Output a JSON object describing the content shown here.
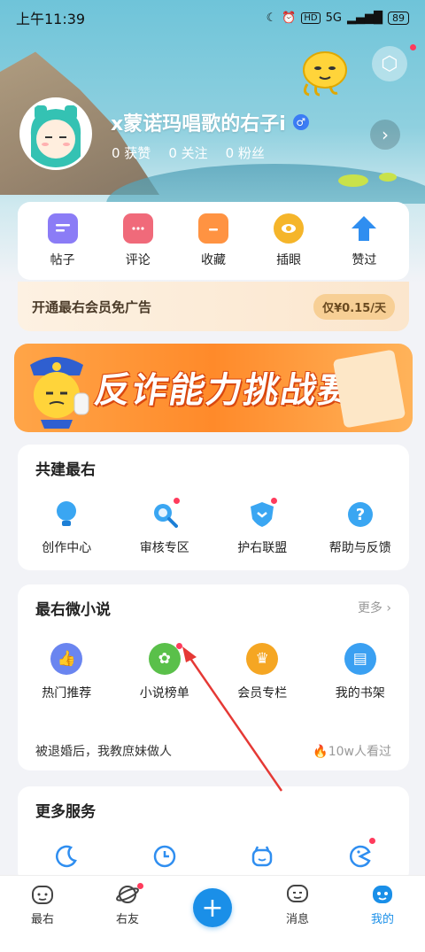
{
  "status_bar": {
    "time": "上午11:39",
    "network": "5G",
    "hd": "HD",
    "battery": "89"
  },
  "profile": {
    "username": "x蒙诺玛唱歌的右子i",
    "gender_symbol": "♂",
    "likes": "0 获赞",
    "following": "0 关注",
    "fans": "0 粉丝"
  },
  "quick_actions": [
    {
      "label": "帖子",
      "color": "#8b7cf6"
    },
    {
      "label": "评论",
      "color": "#f06a7a"
    },
    {
      "label": "收藏",
      "color": "#ff9342"
    },
    {
      "label": "插眼",
      "color": "#f5b52a"
    },
    {
      "label": "赞过",
      "color": "#2f8ef0"
    }
  ],
  "vip": {
    "text": "开通最右会员免广告",
    "price": "仅¥0.15/天"
  },
  "banner": {
    "title": "反诈能力挑战赛"
  },
  "cobuild": {
    "title": "共建最右",
    "items": [
      {
        "label": "创作中心"
      },
      {
        "label": "审核专区"
      },
      {
        "label": "护右联盟"
      },
      {
        "label": "帮助与反馈"
      }
    ]
  },
  "novel": {
    "title": "最右微小说",
    "more": "更多 ›",
    "items": [
      {
        "label": "热门推荐",
        "color": "#6a85f0"
      },
      {
        "label": "小说榜单",
        "color": "#5ac04a"
      },
      {
        "label": "会员专栏",
        "color": "#f5a623"
      },
      {
        "label": "我的书架",
        "color": "#3aa0f2"
      }
    ],
    "story_title": "被退婚后，我教庶妹做人",
    "story_views": "10w人看过"
  },
  "services": {
    "title": "更多服务"
  },
  "bottom_nav": [
    {
      "label": "最右"
    },
    {
      "label": "右友"
    },
    {
      "label": ""
    },
    {
      "label": "消息"
    },
    {
      "label": "我的"
    }
  ],
  "colors": {
    "accent": "#1a8fe8",
    "annotation_arrow": "#e53935"
  }
}
